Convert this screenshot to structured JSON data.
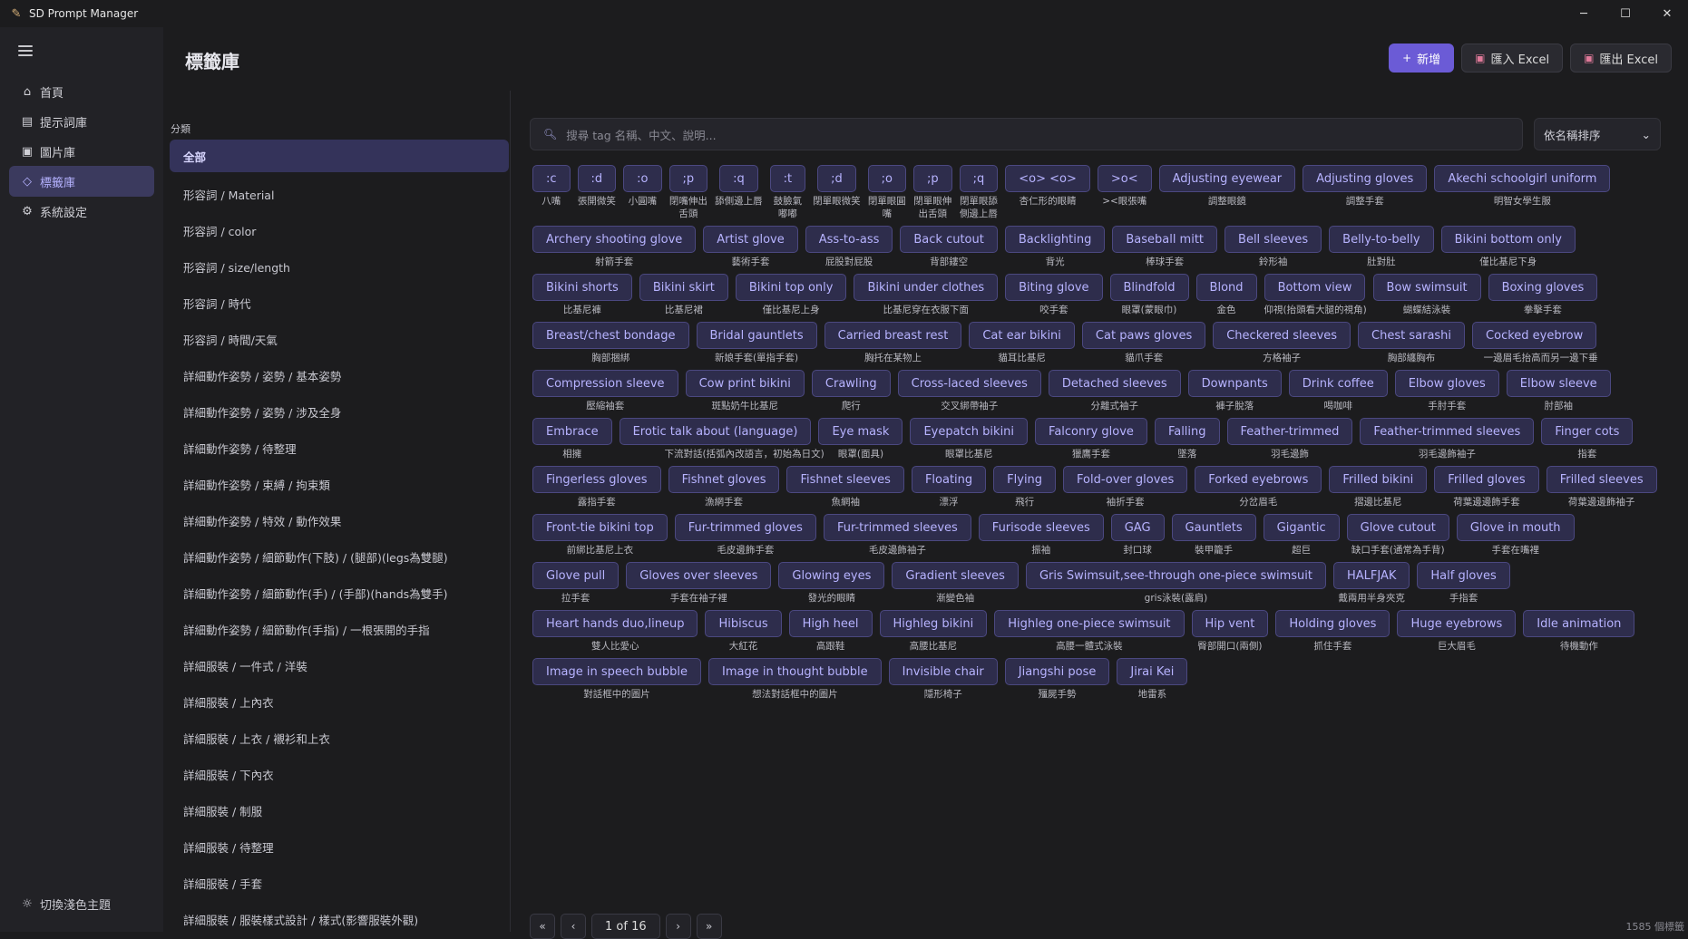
{
  "app": {
    "title": "SD Prompt Manager"
  },
  "window_controls": {
    "minimize": "─",
    "maximize": "☐",
    "close": "✕"
  },
  "nav": {
    "items": [
      {
        "label": "首頁",
        "icon": "home-icon",
        "glyph": "⌂"
      },
      {
        "label": "提示詞庫",
        "icon": "document-icon",
        "glyph": "▤"
      },
      {
        "label": "圖片庫",
        "icon": "image-icon",
        "glyph": "▣"
      },
      {
        "label": "標籤庫",
        "icon": "tag-icon",
        "glyph": "◇"
      },
      {
        "label": "系統設定",
        "icon": "gear-icon",
        "glyph": "⚙"
      }
    ],
    "active": 3,
    "theme_toggle": "切換淺色主題"
  },
  "page": {
    "title": "標籤庫"
  },
  "toolbar": {
    "add": "新增",
    "import": "匯入 Excel",
    "export": "匯出 Excel"
  },
  "categories": {
    "header": "分類",
    "items": [
      "全部",
      "形容詞 / Material",
      "形容詞 / color",
      "形容詞 / size/length",
      "形容詞 / 時代",
      "形容詞 / 時間/天氣",
      "詳細動作姿勢 / 姿勢 / 基本姿勢",
      "詳細動作姿勢 / 姿勢 / 涉及全身",
      "詳細動作姿勢 / 待整理",
      "詳細動作姿勢 / 束縛 / 拘束類",
      "詳細動作姿勢 / 特效 / 動作效果",
      "詳細動作姿勢 / 細節動作(下肢) / (腿部)(legs為雙腿)",
      "詳細動作姿勢 / 細節動作(手) / (手部)(hands為雙手)",
      "詳細動作姿勢 / 細節動作(手指) / 一根張開的手指",
      "詳細服裝 / 一件式 / 洋裝",
      "詳細服裝 / 上內衣",
      "詳細服裝 / 上衣 / 襯衫和上衣",
      "詳細服裝 / 下內衣",
      "詳細服裝 / 制服",
      "詳細服裝 / 待整理",
      "詳細服裝 / 手套",
      "詳細服裝 / 服裝樣式設計 / 樣式(影響服裝外觀)"
    ]
  },
  "search": {
    "placeholder": "搜尋 tag 名稱、中文、說明..."
  },
  "sort": {
    "value": "依名稱排序"
  },
  "tags": [
    {
      "name": ":c",
      "tr": "八嘴"
    },
    {
      "name": ":d",
      "tr": "張開微笑"
    },
    {
      "name": ":o",
      "tr": "小圓嘴"
    },
    {
      "name": ";p",
      "tr": "閉嘴伸出舌頭"
    },
    {
      "name": ":q",
      "tr": "舔側邊上唇"
    },
    {
      "name": ":t",
      "tr": "鼓臉氣嘟嘟"
    },
    {
      "name": ";d",
      "tr": "閉單眼微笑"
    },
    {
      "name": ";o",
      "tr": "閉單眼圓嘴"
    },
    {
      "name": ";p",
      "tr": "閉單眼伸出舌頭"
    },
    {
      "name": ";q",
      "tr": "閉單眼舔側邊上唇"
    },
    {
      "name": "<o> <o>",
      "tr": "杏仁形的眼睛"
    },
    {
      "name": ">o<",
      "tr": "><眼張嘴"
    },
    {
      "name": "Adjusting eyewear",
      "tr": "調整眼鏡"
    },
    {
      "name": "Adjusting gloves",
      "tr": "調整手套"
    },
    {
      "name": "Akechi schoolgirl uniform",
      "tr": "明智女學生服"
    },
    {
      "name": "Archery shooting glove",
      "tr": "射箭手套"
    },
    {
      "name": "Artist glove",
      "tr": "藝術手套"
    },
    {
      "name": "Ass-to-ass",
      "tr": "屁股對屁股"
    },
    {
      "name": "Back cutout",
      "tr": "背部鏤空"
    },
    {
      "name": "Backlighting",
      "tr": "背光"
    },
    {
      "name": "Baseball mitt",
      "tr": "棒球手套"
    },
    {
      "name": "Bell sleeves",
      "tr": "鈴形袖"
    },
    {
      "name": "Belly-to-belly",
      "tr": "肚對肚"
    },
    {
      "name": "Bikini bottom only",
      "tr": "僅比基尼下身"
    },
    {
      "name": "Bikini shorts",
      "tr": "比基尼褲"
    },
    {
      "name": "Bikini skirt",
      "tr": "比基尼裙"
    },
    {
      "name": "Bikini top only",
      "tr": "僅比基尼上身"
    },
    {
      "name": "Bikini under clothes",
      "tr": "比基尼穿在衣服下面"
    },
    {
      "name": "Biting glove",
      "tr": "咬手套"
    },
    {
      "name": "Blindfold",
      "tr": "眼罩(蒙眼巾)"
    },
    {
      "name": "Blond",
      "tr": "金色"
    },
    {
      "name": "Bottom view",
      "tr": "仰視(抬頭看大腿的視角)"
    },
    {
      "name": "Bow swimsuit",
      "tr": "蝴蝶結泳裝"
    },
    {
      "name": "Boxing gloves",
      "tr": "拳擊手套"
    },
    {
      "name": "Breast/chest bondage",
      "tr": "胸部捆綁"
    },
    {
      "name": "Bridal gauntlets",
      "tr": "新娘手套(單指手套)"
    },
    {
      "name": "Carried breast rest",
      "tr": "胸托在某物上"
    },
    {
      "name": "Cat ear bikini",
      "tr": "貓耳比基尼"
    },
    {
      "name": "Cat paws gloves",
      "tr": "貓爪手套"
    },
    {
      "name": "Checkered sleeves",
      "tr": "方格袖子"
    },
    {
      "name": "Chest sarashi",
      "tr": "胸部纏胸布"
    },
    {
      "name": "Cocked eyebrow",
      "tr": "一邊眉毛抬高而另一邊下垂"
    },
    {
      "name": "Compression sleeve",
      "tr": "壓縮袖套"
    },
    {
      "name": "Cow print bikini",
      "tr": "斑點奶牛比基尼"
    },
    {
      "name": "Crawling",
      "tr": "爬行"
    },
    {
      "name": "Cross-laced sleeves",
      "tr": "交叉綁帶袖子"
    },
    {
      "name": "Detached sleeves",
      "tr": "分離式袖子"
    },
    {
      "name": "Downpants",
      "tr": "褲子脫落"
    },
    {
      "name": "Drink coffee",
      "tr": "喝咖啡"
    },
    {
      "name": "Elbow gloves",
      "tr": "手肘手套"
    },
    {
      "name": "Elbow sleeve",
      "tr": "肘部袖"
    },
    {
      "name": "Embrace",
      "tr": "相擁"
    },
    {
      "name": "Erotic talk about (language)",
      "tr": "下流對話(括弧內改語言，初始為日文)"
    },
    {
      "name": "Eye mask",
      "tr": "眼罩(面具)"
    },
    {
      "name": "Eyepatch bikini",
      "tr": "眼罩比基尼"
    },
    {
      "name": "Falconry glove",
      "tr": "獵鷹手套"
    },
    {
      "name": "Falling",
      "tr": "墜落"
    },
    {
      "name": "Feather-trimmed",
      "tr": "羽毛邊飾"
    },
    {
      "name": "Feather-trimmed sleeves",
      "tr": "羽毛邊飾袖子"
    },
    {
      "name": "Finger cots",
      "tr": "指套"
    },
    {
      "name": "Fingerless gloves",
      "tr": "露指手套"
    },
    {
      "name": "Fishnet gloves",
      "tr": "漁網手套"
    },
    {
      "name": "Fishnet sleeves",
      "tr": "魚網袖"
    },
    {
      "name": "Floating",
      "tr": "漂浮"
    },
    {
      "name": "Flying",
      "tr": "飛行"
    },
    {
      "name": "Fold-over gloves",
      "tr": "袖折手套"
    },
    {
      "name": "Forked eyebrows",
      "tr": "分岔眉毛"
    },
    {
      "name": "Frilled bikini",
      "tr": "摺邊比基尼"
    },
    {
      "name": "Frilled gloves",
      "tr": "荷葉邊邊飾手套"
    },
    {
      "name": "Frilled sleeves",
      "tr": "荷葉邊邊飾袖子"
    },
    {
      "name": "Front-tie bikini top",
      "tr": "前綁比基尼上衣"
    },
    {
      "name": "Fur-trimmed gloves",
      "tr": "毛皮邊飾手套"
    },
    {
      "name": "Fur-trimmed sleeves",
      "tr": "毛皮邊飾袖子"
    },
    {
      "name": "Furisode sleeves",
      "tr": "振袖"
    },
    {
      "name": "GAG",
      "tr": "封口球"
    },
    {
      "name": "Gauntlets",
      "tr": "裝甲籠手"
    },
    {
      "name": "Gigantic",
      "tr": "超巨"
    },
    {
      "name": "Glove cutout",
      "tr": "缺口手套(通常為手背)"
    },
    {
      "name": "Glove in mouth",
      "tr": "手套在嘴裡"
    },
    {
      "name": "Glove pull",
      "tr": "拉手套"
    },
    {
      "name": "Gloves over sleeves",
      "tr": "手套在袖子裡"
    },
    {
      "name": "Glowing eyes",
      "tr": "發光的眼睛"
    },
    {
      "name": "Gradient sleeves",
      "tr": "漸變色袖"
    },
    {
      "name": "Gris Swimsuit,see-through one-piece swimsuit",
      "tr": "gris泳裝(露肩)"
    },
    {
      "name": "HALFJAK",
      "tr": "戴兩用半身夾克"
    },
    {
      "name": "Half gloves",
      "tr": "手指套"
    },
    {
      "name": "Heart hands duo,lineup",
      "tr": "雙人比愛心"
    },
    {
      "name": "Hibiscus",
      "tr": "大紅花"
    },
    {
      "name": "High heel",
      "tr": "高跟鞋"
    },
    {
      "name": "Highleg bikini",
      "tr": "高腰比基尼"
    },
    {
      "name": "Highleg one-piece swimsuit",
      "tr": "高腰一體式泳裝"
    },
    {
      "name": "Hip vent",
      "tr": "臀部開口(兩側)"
    },
    {
      "name": "Holding gloves",
      "tr": "抓住手套"
    },
    {
      "name": "Huge eyebrows",
      "tr": "巨大眉毛"
    },
    {
      "name": "Idle animation",
      "tr": "待機動作"
    },
    {
      "name": "Image in speech bubble",
      "tr": "對話框中的圖片"
    },
    {
      "name": "Image in thought bubble",
      "tr": "想法對話框中的圖片"
    },
    {
      "name": "Invisible chair",
      "tr": "隱形椅子"
    },
    {
      "name": "Jiangshi pose",
      "tr": "殭屍手勢"
    },
    {
      "name": "Jirai Kei",
      "tr": "地雷系"
    }
  ],
  "pagination": {
    "first": "«",
    "prev": "‹",
    "label": "1 of 16",
    "next": "›",
    "last": "»",
    "count": "1585 個標籤"
  }
}
